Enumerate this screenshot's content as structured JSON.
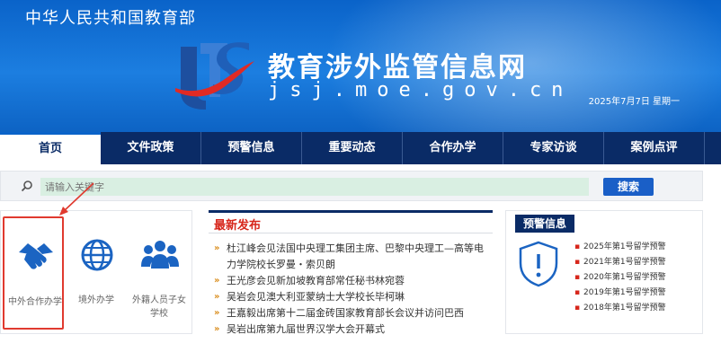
{
  "header": {
    "ministry": "中华人民共和国教育部",
    "site_name": "教育涉外监管信息网",
    "domain": "jsj.moe.gov.cn",
    "date": "2025年7月7日  星期一"
  },
  "nav": {
    "items": [
      {
        "label": "首页"
      },
      {
        "label": "文件政策"
      },
      {
        "label": "预警信息"
      },
      {
        "label": "重要动态"
      },
      {
        "label": "合作办学"
      },
      {
        "label": "专家访谈"
      },
      {
        "label": "案例点评"
      }
    ]
  },
  "search": {
    "placeholder": "请输入关键字",
    "button_label": "搜索"
  },
  "services": [
    {
      "label": "中外合作办学",
      "icon": "handshake-icon"
    },
    {
      "label": "境外办学",
      "icon": "globe-icon"
    },
    {
      "label": "外籍人员子女学校",
      "icon": "people-icon"
    }
  ],
  "news": {
    "title": "最新发布",
    "items": [
      "杜江峰会见法国中央理工集团主席、巴黎中央理工—高等电力学院校长罗曼・索贝朗",
      "王光彦会见新加坡教育部常任秘书林宛蓉",
      "吴岩会见澳大利亚蒙纳士大学校长毕柯琳",
      "王嘉毅出席第十二届金砖国家教育部长会议并访问巴西",
      "吴岩出席第九届世界汉学大会开幕式"
    ]
  },
  "alert": {
    "title": "预警信息",
    "items": [
      "2025年第1号留学预警",
      "2021年第1号留学预警",
      "2020年第1号留学预警",
      "2019年第1号留学预警",
      "2018年第1号留学预警"
    ]
  },
  "colors": {
    "brand_blue": "#0a63c9",
    "nav_navy": "#0a2b66",
    "accent_red": "#d7261b"
  }
}
